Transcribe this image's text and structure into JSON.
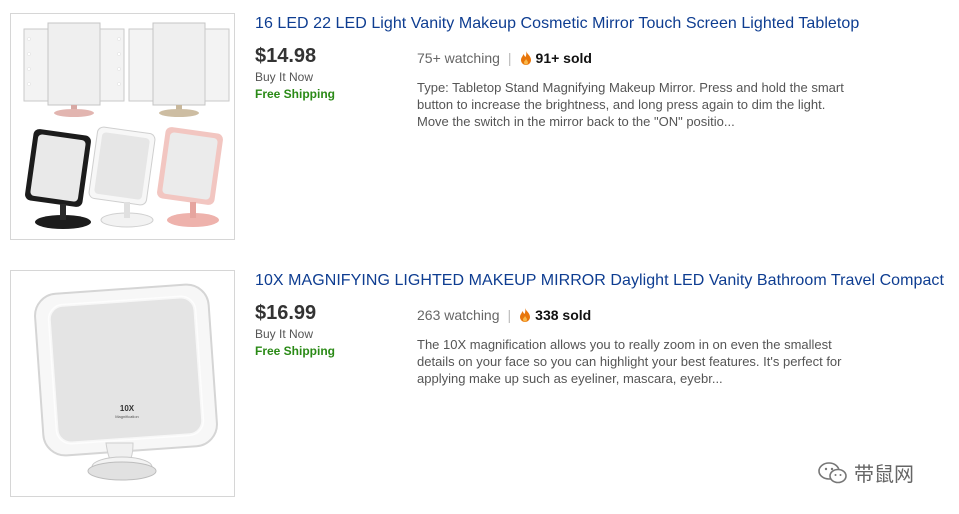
{
  "listings": [
    {
      "title": "16 LED 22 LED Light Vanity Makeup Cosmetic Mirror Touch Screen Lighted Tabletop",
      "price": "$14.98",
      "buy_it_now": "Buy It Now",
      "shipping": "Free Shipping",
      "watching": "75+ watching",
      "separator": "|",
      "sold": "91+ sold",
      "description": "Type: Tabletop Stand Magnifying Makeup Mirror. Press and hold the smart button to increase the brightness, and long press again to dim the light. Move the switch in the mirror back to the \"ON\" positio...",
      "image_icon": "led-vanity-mirrors-image"
    },
    {
      "title": "10X MAGNIFYING LIGHTED MAKEUP MIRROR Daylight LED Vanity Bathroom Travel Compact",
      "price": "$16.99",
      "buy_it_now": "Buy It Now",
      "shipping": "Free Shipping",
      "watching": "263 watching",
      "separator": "|",
      "sold": "338 sold",
      "description": "The 10X magnification allows you to really zoom in on even the smallest details on your face so you can highlight your best features. It's perfect for applying make up such as eyeliner, mascara, eyebr...",
      "image_icon": "magnifying-mirror-image",
      "mirror_label": "10X",
      "mirror_sublabel": "Magnification"
    }
  ],
  "watermark": {
    "text": "带鼠网",
    "icon": "wechat-icon"
  },
  "colors": {
    "title_link": "#0e3d91",
    "price": "#333333",
    "free_shipping": "#2a8a16",
    "fire": "#e8760b",
    "thumb_border": "#d6d6d6"
  }
}
